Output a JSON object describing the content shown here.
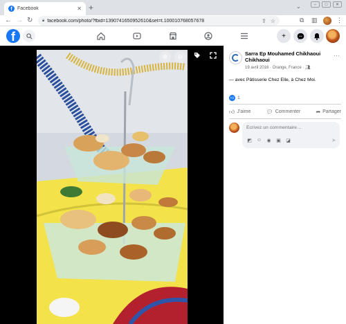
{
  "browser": {
    "tab_title": "Facebook",
    "tab_close": "✕",
    "new_tab": "+",
    "url": "facebook.com/photo/?fbid=1390741650952610&set=t.100010768057678",
    "nav": {
      "back": "←",
      "forward": "→",
      "reload": "↻"
    }
  },
  "header": {
    "logo": "f",
    "icons": [
      "home-icon",
      "watch-icon",
      "marketplace-icon",
      "groups-icon",
      "menu-icon"
    ],
    "right_icons": [
      "create-icon",
      "messenger-icon",
      "notifications-icon"
    ]
  },
  "viewer": {
    "controls": [
      "zoom-in-icon",
      "zoom-out-icon",
      "tag-icon",
      "fullscreen-icon"
    ]
  },
  "post": {
    "author": "Sarra Ep Mouhamed Chikhaoui Chikhaoui",
    "date": "19 avril 2016",
    "location": "Orange, France",
    "caption": "— avec Pâtisserie Chez Elle, à Chez Moi.",
    "reaction_count": "1",
    "actions": {
      "like": "J'aime",
      "comment": "Commenter",
      "share": "Partager"
    }
  },
  "comment": {
    "placeholder": "Écrivez un commentaire…"
  },
  "colors": {
    "brand": "#1877f2",
    "background": "#ffffff",
    "viewer_bg": "#000000"
  }
}
